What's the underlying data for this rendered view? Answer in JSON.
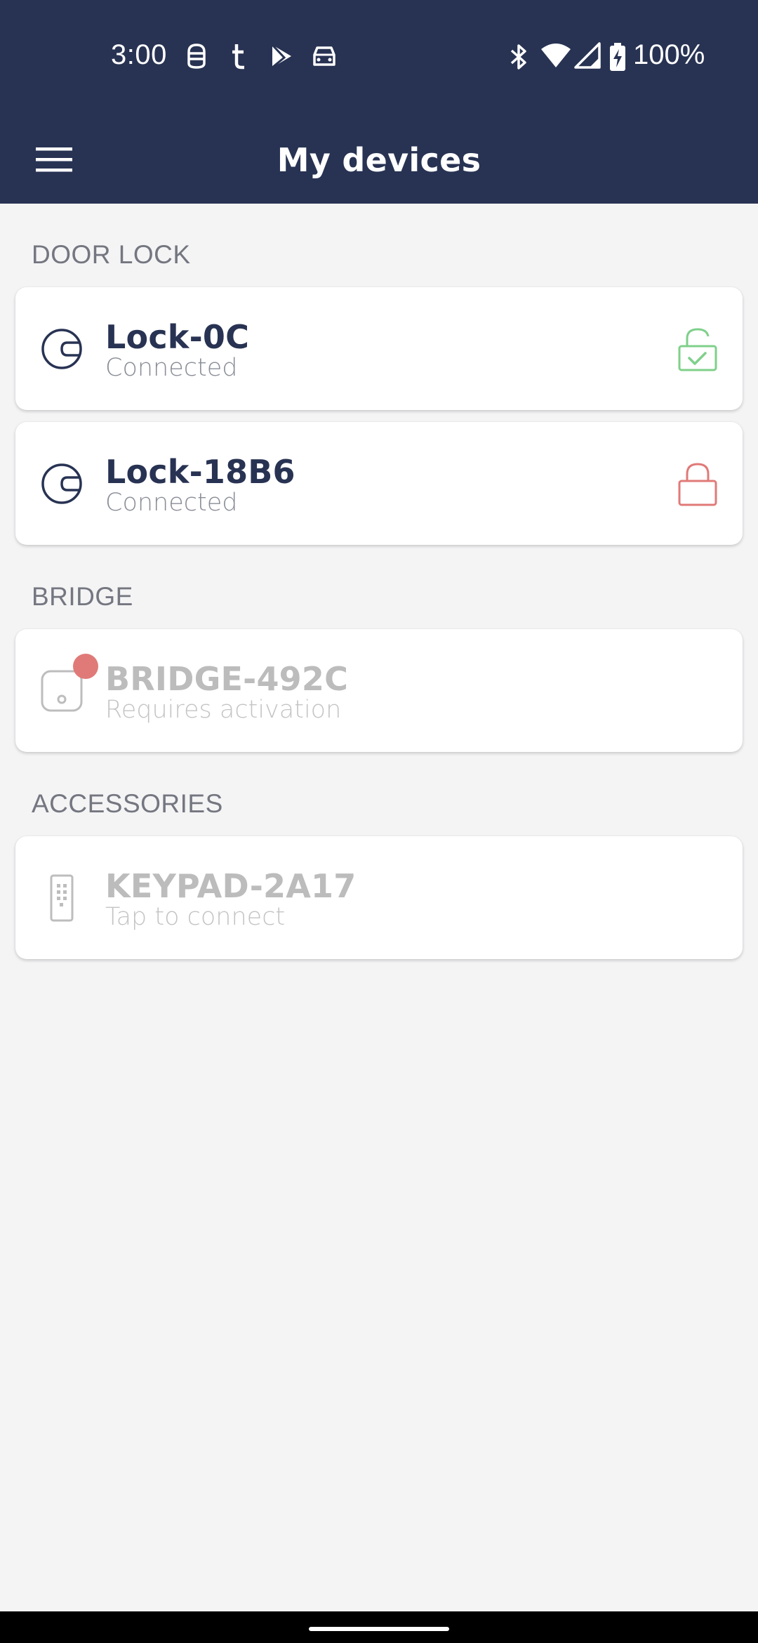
{
  "status_bar": {
    "time": "3:00",
    "battery": "100%",
    "icons": [
      "robot-icon",
      "tumblr-icon",
      "play-store-icon",
      "car-icon",
      "bluetooth-icon",
      "wifi-icon",
      "signal-icon",
      "battery-charging-icon"
    ]
  },
  "app_bar": {
    "title": "My devices",
    "menu_icon": "hamburger-menu-icon"
  },
  "sections": {
    "door_lock": {
      "header": "DOOR LOCK",
      "devices": [
        {
          "name": "Lock-0C",
          "status": "Connected",
          "icon": "lock-device-icon",
          "state_icon": "unlocked-check-icon"
        },
        {
          "name": "Lock-18B6",
          "status": "Connected",
          "icon": "lock-device-icon",
          "state_icon": "locked-icon"
        }
      ]
    },
    "bridge": {
      "header": "BRIDGE",
      "devices": [
        {
          "name": "BRIDGE-492C",
          "status": "Requires activation",
          "icon": "bridge-device-icon",
          "badge": "notification-dot"
        }
      ]
    },
    "accessories": {
      "header": "ACCESSORIES",
      "devices": [
        {
          "name": "KEYPAD-2A17",
          "status": "Tap to connect",
          "icon": "keypad-icon"
        }
      ]
    }
  },
  "colors": {
    "header_bg": "#283353",
    "background": "#f4f4f5",
    "unlocked": "#7fd08a",
    "locked": "#e07a78",
    "badge": "#e07a78",
    "disabled": "#bcbcbc"
  }
}
